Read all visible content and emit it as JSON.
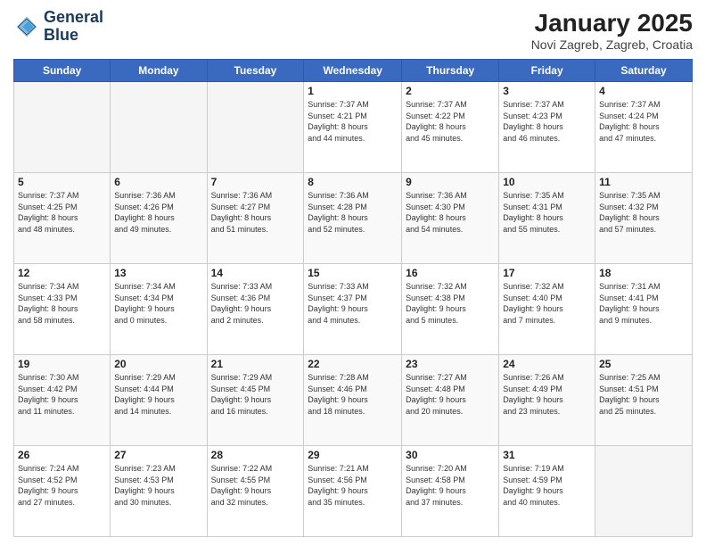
{
  "logo": {
    "line1": "General",
    "line2": "Blue"
  },
  "header": {
    "month": "January 2025",
    "location": "Novi Zagreb, Zagreb, Croatia"
  },
  "weekdays": [
    "Sunday",
    "Monday",
    "Tuesday",
    "Wednesday",
    "Thursday",
    "Friday",
    "Saturday"
  ],
  "weeks": [
    [
      {
        "day": "",
        "info": ""
      },
      {
        "day": "",
        "info": ""
      },
      {
        "day": "",
        "info": ""
      },
      {
        "day": "1",
        "info": "Sunrise: 7:37 AM\nSunset: 4:21 PM\nDaylight: 8 hours\nand 44 minutes."
      },
      {
        "day": "2",
        "info": "Sunrise: 7:37 AM\nSunset: 4:22 PM\nDaylight: 8 hours\nand 45 minutes."
      },
      {
        "day": "3",
        "info": "Sunrise: 7:37 AM\nSunset: 4:23 PM\nDaylight: 8 hours\nand 46 minutes."
      },
      {
        "day": "4",
        "info": "Sunrise: 7:37 AM\nSunset: 4:24 PM\nDaylight: 8 hours\nand 47 minutes."
      }
    ],
    [
      {
        "day": "5",
        "info": "Sunrise: 7:37 AM\nSunset: 4:25 PM\nDaylight: 8 hours\nand 48 minutes."
      },
      {
        "day": "6",
        "info": "Sunrise: 7:36 AM\nSunset: 4:26 PM\nDaylight: 8 hours\nand 49 minutes."
      },
      {
        "day": "7",
        "info": "Sunrise: 7:36 AM\nSunset: 4:27 PM\nDaylight: 8 hours\nand 51 minutes."
      },
      {
        "day": "8",
        "info": "Sunrise: 7:36 AM\nSunset: 4:28 PM\nDaylight: 8 hours\nand 52 minutes."
      },
      {
        "day": "9",
        "info": "Sunrise: 7:36 AM\nSunset: 4:30 PM\nDaylight: 8 hours\nand 54 minutes."
      },
      {
        "day": "10",
        "info": "Sunrise: 7:35 AM\nSunset: 4:31 PM\nDaylight: 8 hours\nand 55 minutes."
      },
      {
        "day": "11",
        "info": "Sunrise: 7:35 AM\nSunset: 4:32 PM\nDaylight: 8 hours\nand 57 minutes."
      }
    ],
    [
      {
        "day": "12",
        "info": "Sunrise: 7:34 AM\nSunset: 4:33 PM\nDaylight: 8 hours\nand 58 minutes."
      },
      {
        "day": "13",
        "info": "Sunrise: 7:34 AM\nSunset: 4:34 PM\nDaylight: 9 hours\nand 0 minutes."
      },
      {
        "day": "14",
        "info": "Sunrise: 7:33 AM\nSunset: 4:36 PM\nDaylight: 9 hours\nand 2 minutes."
      },
      {
        "day": "15",
        "info": "Sunrise: 7:33 AM\nSunset: 4:37 PM\nDaylight: 9 hours\nand 4 minutes."
      },
      {
        "day": "16",
        "info": "Sunrise: 7:32 AM\nSunset: 4:38 PM\nDaylight: 9 hours\nand 5 minutes."
      },
      {
        "day": "17",
        "info": "Sunrise: 7:32 AM\nSunset: 4:40 PM\nDaylight: 9 hours\nand 7 minutes."
      },
      {
        "day": "18",
        "info": "Sunrise: 7:31 AM\nSunset: 4:41 PM\nDaylight: 9 hours\nand 9 minutes."
      }
    ],
    [
      {
        "day": "19",
        "info": "Sunrise: 7:30 AM\nSunset: 4:42 PM\nDaylight: 9 hours\nand 11 minutes."
      },
      {
        "day": "20",
        "info": "Sunrise: 7:29 AM\nSunset: 4:44 PM\nDaylight: 9 hours\nand 14 minutes."
      },
      {
        "day": "21",
        "info": "Sunrise: 7:29 AM\nSunset: 4:45 PM\nDaylight: 9 hours\nand 16 minutes."
      },
      {
        "day": "22",
        "info": "Sunrise: 7:28 AM\nSunset: 4:46 PM\nDaylight: 9 hours\nand 18 minutes."
      },
      {
        "day": "23",
        "info": "Sunrise: 7:27 AM\nSunset: 4:48 PM\nDaylight: 9 hours\nand 20 minutes."
      },
      {
        "day": "24",
        "info": "Sunrise: 7:26 AM\nSunset: 4:49 PM\nDaylight: 9 hours\nand 23 minutes."
      },
      {
        "day": "25",
        "info": "Sunrise: 7:25 AM\nSunset: 4:51 PM\nDaylight: 9 hours\nand 25 minutes."
      }
    ],
    [
      {
        "day": "26",
        "info": "Sunrise: 7:24 AM\nSunset: 4:52 PM\nDaylight: 9 hours\nand 27 minutes."
      },
      {
        "day": "27",
        "info": "Sunrise: 7:23 AM\nSunset: 4:53 PM\nDaylight: 9 hours\nand 30 minutes."
      },
      {
        "day": "28",
        "info": "Sunrise: 7:22 AM\nSunset: 4:55 PM\nDaylight: 9 hours\nand 32 minutes."
      },
      {
        "day": "29",
        "info": "Sunrise: 7:21 AM\nSunset: 4:56 PM\nDaylight: 9 hours\nand 35 minutes."
      },
      {
        "day": "30",
        "info": "Sunrise: 7:20 AM\nSunset: 4:58 PM\nDaylight: 9 hours\nand 37 minutes."
      },
      {
        "day": "31",
        "info": "Sunrise: 7:19 AM\nSunset: 4:59 PM\nDaylight: 9 hours\nand 40 minutes."
      },
      {
        "day": "",
        "info": ""
      }
    ]
  ]
}
